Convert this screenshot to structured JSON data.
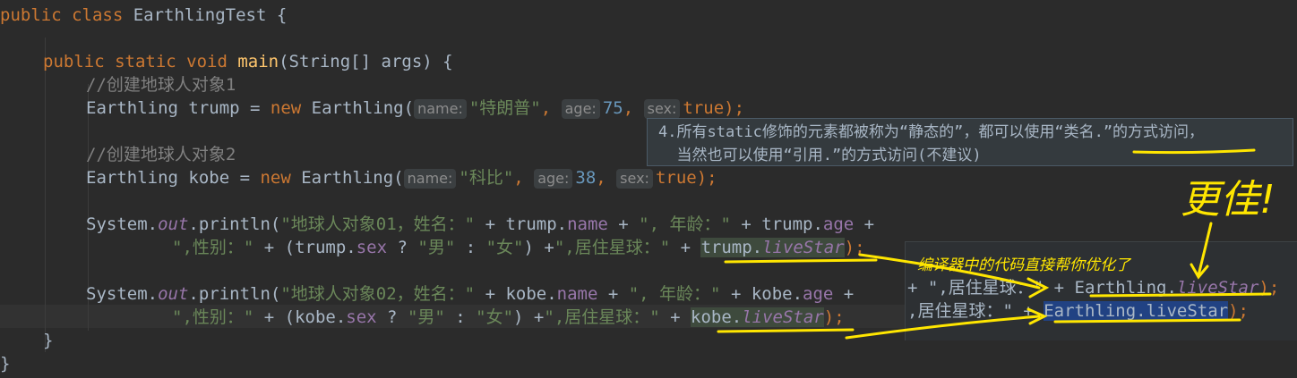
{
  "editor": {
    "class_decl": {
      "kw": "public class ",
      "name": "EarthlingTest",
      "brace": " {"
    },
    "main_decl": {
      "kw": "public static void ",
      "name": "main",
      "params": "(String[] args) {"
    },
    "comment1": "//创建地球人对象1",
    "trump_line": {
      "type": "Earthling trump = ",
      "kw_new": "new",
      "ctor": " Earthling(",
      "hint_name": "name:",
      "arg_name": "\"特朗普\"",
      "sep1": ", ",
      "hint_age": "age:",
      "arg_age": "75",
      "sep2": ", ",
      "hint_sex": "sex:",
      "arg_sex": "true",
      "end": ");"
    },
    "comment2": "//创建地球人对象2",
    "kobe_line": {
      "type": "Earthling kobe = ",
      "kw_new": "new",
      "ctor": " Earthling(",
      "hint_name": "name:",
      "arg_name": "\"科比\"",
      "sep1": ", ",
      "hint_age": "age:",
      "arg_age": "38",
      "sep2": ", ",
      "hint_sex": "sex:",
      "arg_sex": "true",
      "end": ");"
    },
    "print1_a": {
      "sys": "System.",
      "out": "out",
      "println": ".println(",
      "s1": "\"地球人对象01，姓名：\"",
      "p1": " + trump.",
      "f1": "name",
      "p2": " + ",
      "s2": "\", 年龄：\"",
      "p3": " + trump.",
      "f2": "age",
      "p4": " +"
    },
    "print1_b": {
      "s1": "\",性别：\"",
      "p1": " + (trump.",
      "f1": "sex",
      "p2": " ? ",
      "s2": "\"男\"",
      "p3": " : ",
      "s3": "\"女\"",
      "p4": ") +",
      "s4": "\",居住星球：\"",
      "p5": " + ",
      "obj": "trump.",
      "f2": "liveStar",
      "end": ");"
    },
    "print2_a": {
      "sys": "System.",
      "out": "out",
      "println": ".println(",
      "s1": "\"地球人对象02，姓名：\"",
      "p1": " + kobe.",
      "f1": "name",
      "p2": " + ",
      "s2": "\", 年龄：\"",
      "p3": " + kobe.",
      "f2": "age",
      "p4": " +"
    },
    "print2_b": {
      "s1": "\",性别：\"",
      "p1": " + (kobe.",
      "f1": "sex",
      "p2": " ? ",
      "s2": "\"男\"",
      "p3": " : ",
      "s3": "\"女\"",
      "p4": ") +",
      "s4": "\",居住星球：\"",
      "p5": " + ",
      "obj": "kobe.",
      "f2": "liveStar",
      "end": ");"
    },
    "close_method": "}",
    "close_class": "}"
  },
  "tooltip": {
    "line1": "4.所有static修饰的元素都被称为“静态的”，都可以使用“类名.”的方式访问，",
    "line2": "  当然也可以使用“引用.”的方式访问(不建议)"
  },
  "popup": {
    "label": "编译器中的代码直接帮你优化了",
    "row1": {
      "pre": "+ \",居住星球：\" + ",
      "cls": "Earthling.",
      "fld": "liveStar",
      "end": ");"
    },
    "row2": {
      "pre": ",居住星球：\" + ",
      "cls": "Earthling.",
      "fld": "liveStar",
      "end": ");"
    }
  },
  "annotation": {
    "handwritten": "更佳!"
  },
  "colors": {
    "background": "#2b2b2b",
    "keyword": "#cc7832",
    "string": "#6a8759",
    "number": "#6897bb",
    "field": "#9876aa",
    "method": "#ffc66d",
    "annotation": "#ffe600"
  }
}
